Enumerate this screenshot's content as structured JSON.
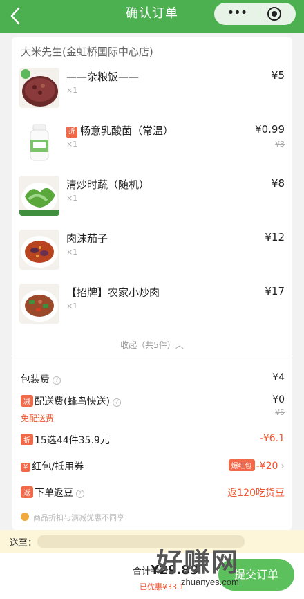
{
  "header": {
    "back_icon": "chevron-left-icon",
    "title": "确认订单",
    "more_label": "•••"
  },
  "shop_name": "大米先生(金虹桥国际中心店)",
  "items": [
    {
      "name": "——杂粮饭——",
      "qty": "×1",
      "price": "¥5",
      "orig": "",
      "discount_tag": ""
    },
    {
      "name": "畅意乳酸菌（常温）",
      "qty": "×1",
      "price": "¥0.99",
      "orig": "¥3",
      "discount_tag": "折"
    },
    {
      "name": "清炒时蔬（随机）",
      "qty": "×1",
      "price": "¥8",
      "orig": "",
      "discount_tag": ""
    },
    {
      "name": "肉沫茄子",
      "qty": "×1",
      "price": "¥12",
      "orig": "",
      "discount_tag": ""
    },
    {
      "name": "【招牌】农家小炒肉",
      "qty": "×1",
      "price": "¥17",
      "orig": "",
      "discount_tag": ""
    }
  ],
  "collapse_label": "收起（共5件）︿",
  "fees": {
    "packaging_label": "包装费",
    "packaging_value": "¥4",
    "delivery_badge": "减",
    "delivery_label": "配送费(蜂鸟快送)",
    "delivery_value": "¥0",
    "delivery_free": "免配送费",
    "delivery_orig": "¥5"
  },
  "promos": {
    "discount_badge": "折",
    "discount_label": "15选44件35.9元",
    "discount_value": "-¥6.1",
    "redpacket_badge": "¥",
    "redpacket_label": "红包/抵用券",
    "redpacket_tag": "爆红包",
    "redpacket_value": "-¥20",
    "rebate_badge": "返",
    "rebate_label": "下单返豆",
    "rebate_value": "返120吃货豆"
  },
  "notice": "商品折扣与满减优惠不同享",
  "address": {
    "label": "送至："
  },
  "footer": {
    "total_prefix": "合计",
    "total_amount": "¥29.89",
    "saved": "已优惠¥33.1",
    "pay_label": "提交订单"
  },
  "watermark": {
    "big": "好赚网",
    "small": "zhuanyes.com"
  },
  "colors": {
    "brand_green": "#4caf50",
    "accent_red": "#f0562f",
    "tag_orange": "#f06a4a"
  }
}
